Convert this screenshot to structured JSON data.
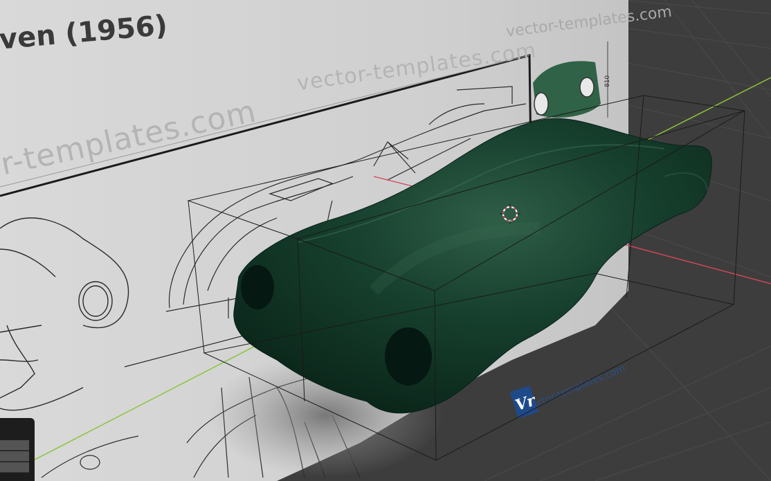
{
  "viewport": {
    "background_color": "#3d3d3d",
    "grid_color": "#4a4a4a",
    "axis_x_color": "#d1455a",
    "axis_y_color": "#8ac43a"
  },
  "blueprint": {
    "title": "ven (1956)",
    "watermarks": {
      "top_right": "vector-templates.com",
      "top_middle": "vector-templates.com",
      "large_left": "r-templates.com",
      "lower_right": "vector-templates.com"
    },
    "dimension_label": "810",
    "logo_text": "Vr",
    "paper_color": "#d6d6d6"
  },
  "model": {
    "body_color": "#0f3325",
    "highlight_color": "#2e5f48"
  },
  "cursor": {
    "icon": "3d-cursor-icon"
  }
}
